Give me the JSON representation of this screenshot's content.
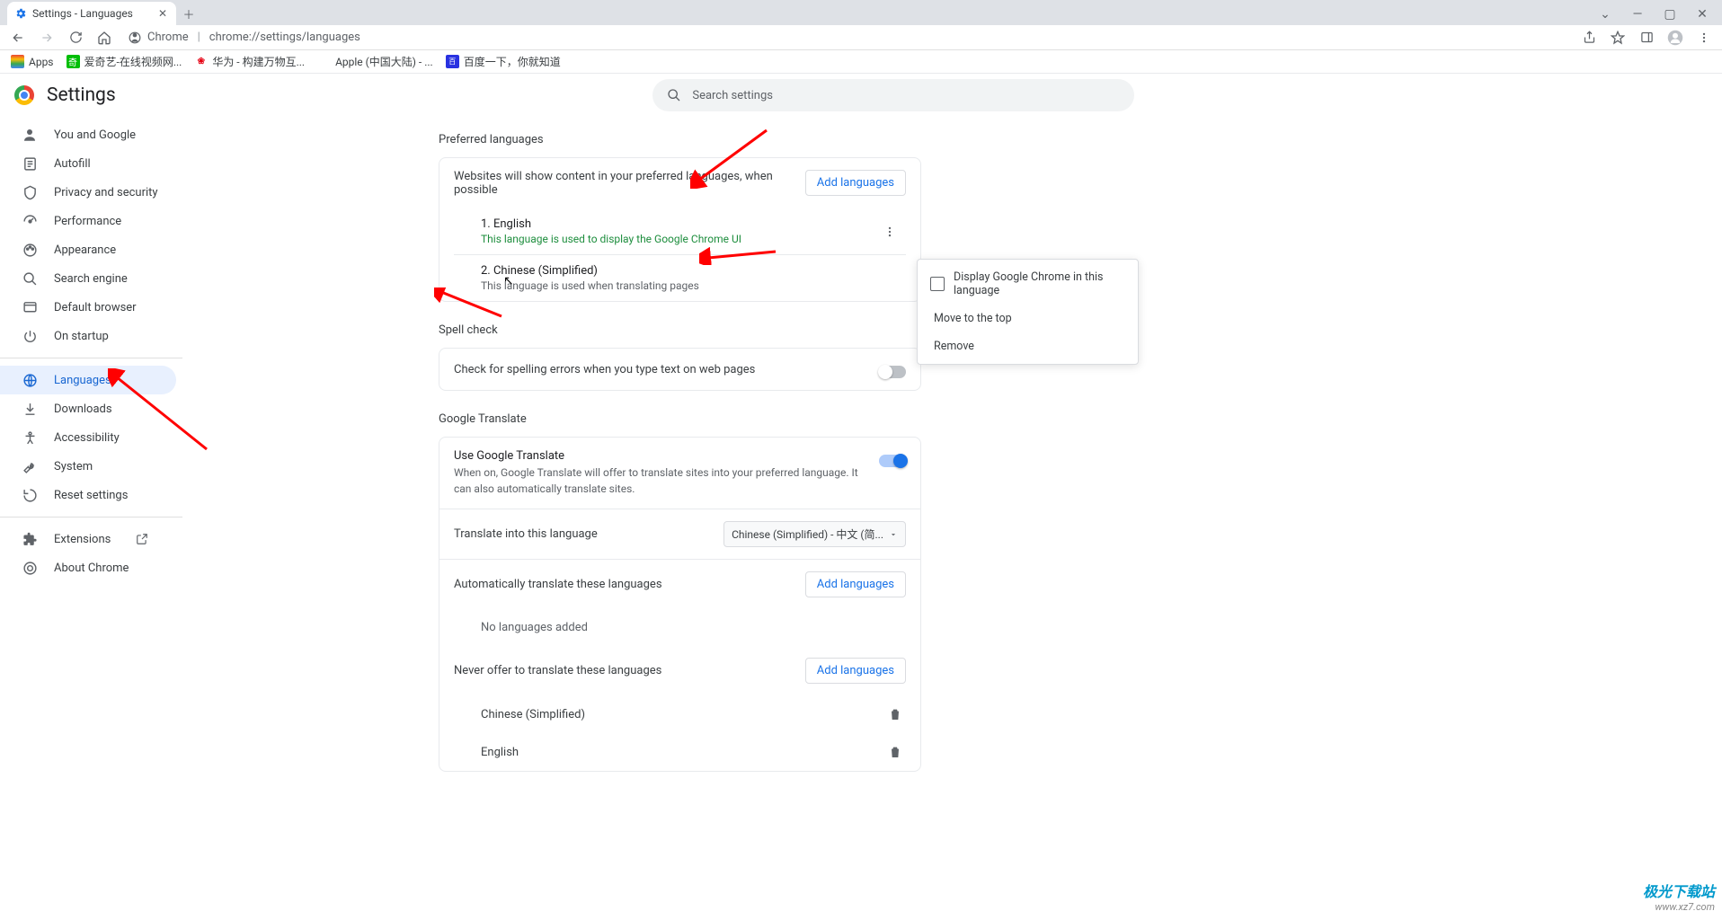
{
  "tab": {
    "title": "Settings - Languages"
  },
  "window_controls": {
    "chevron": "⌄",
    "min": "—",
    "max": "▢",
    "close": "✕"
  },
  "toolbar": {
    "host": "Chrome",
    "path": "chrome://settings/languages"
  },
  "bookmarks": [
    {
      "label": "Apps"
    },
    {
      "label": "爱奇艺-在线视频网..."
    },
    {
      "label": "华为 - 构建万物互..."
    },
    {
      "label": "Apple (中国大陆) - ..."
    },
    {
      "label": "百度一下，你就知道"
    }
  ],
  "settings_title": "Settings",
  "search_placeholder": "Search settings",
  "nav": [
    {
      "label": "You and Google",
      "icon": "person"
    },
    {
      "label": "Autofill",
      "icon": "autofill"
    },
    {
      "label": "Privacy and security",
      "icon": "shield"
    },
    {
      "label": "Performance",
      "icon": "speed"
    },
    {
      "label": "Appearance",
      "icon": "brush"
    },
    {
      "label": "Search engine",
      "icon": "search"
    },
    {
      "label": "Default browser",
      "icon": "browser"
    },
    {
      "label": "On startup",
      "icon": "power"
    }
  ],
  "nav2": [
    {
      "label": "Languages",
      "icon": "globe",
      "active": true
    },
    {
      "label": "Downloads",
      "icon": "download"
    },
    {
      "label": "Accessibility",
      "icon": "accessibility"
    },
    {
      "label": "System",
      "icon": "wrench"
    },
    {
      "label": "Reset settings",
      "icon": "reset"
    }
  ],
  "nav3": [
    {
      "label": "Extensions",
      "icon": "extension",
      "external": true
    },
    {
      "label": "About Chrome",
      "icon": "about"
    }
  ],
  "sections": {
    "preferred_title": "Preferred languages",
    "preferred_desc": "Websites will show content in your preferred languages, when possible",
    "add_languages": "Add languages",
    "lang1_num": "1. ",
    "lang1_name": "English",
    "lang1_desc": "This language is used to display the Google Chrome UI",
    "lang2_num": "2. ",
    "lang2_name": "Chinese (Simplified)",
    "lang2_desc": "This language is used when translating pages",
    "spell_title": "Spell check",
    "spell_desc": "Check for spelling errors when you type text on web pages",
    "translate_title": "Google Translate",
    "use_translate": "Use Google Translate",
    "use_translate_desc": "When on, Google Translate will offer to translate sites into your preferred language. It can also automatically translate sites.",
    "translate_into": "Translate into this language",
    "translate_into_value": "Chinese (Simplified) - 中文 (简...",
    "auto_translate": "Automatically translate these languages",
    "no_languages": "No languages added",
    "never_offer": "Never offer to translate these languages",
    "never1": "Chinese (Simplified)",
    "never2": "English"
  },
  "context_menu": {
    "display": "Display Google Chrome in this language",
    "move_top": "Move to the top",
    "remove": "Remove"
  },
  "watermark": {
    "line1": "极光下载站",
    "line2": "www.xz7.com"
  }
}
